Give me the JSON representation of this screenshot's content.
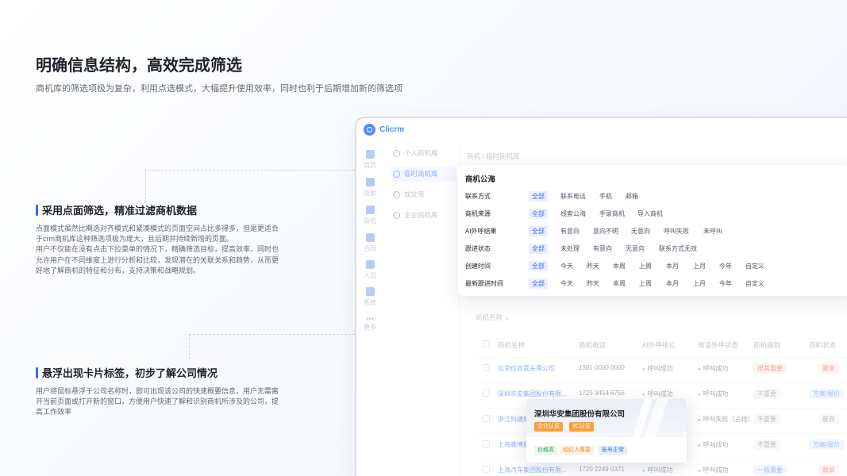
{
  "header": {
    "title": "明确信息结构，高效完成筛选",
    "subtitle": "商机库的筛选项极为复杂，利用点选模式，大幅提升使用效率，同时也利于后期增加新的筛选项"
  },
  "features": [
    {
      "title": "采用点面筛选，精准过滤商机数据",
      "lines": [
        "点面模式虽然比概选对齐模式和紧凑模式的页面空间占比多得多，但是更适合于crm商机库这种筛选项极为庞大，且后期并持续新增的页面。",
        "用户不仅能在没有点击下拉菜单的情况下，精确筛选目标，提高效率，同时也允许用户在不同维度上进行分析和比较，发现潜在的关联关系和趋势，从而更好地了解商机的特征和分布，支持决策和战略规划。"
      ]
    },
    {
      "title": "悬浮出现卡片标签，初步了解公司情况",
      "lines": [
        "用户将鼠标悬浮于公司名称时，即可出现该公司的快速概要信息，用户无需离开当前页面或打开新的窗口，方便用户快速了解和识别商机所涉及的公司，提高工作效率"
      ]
    }
  ],
  "app": {
    "logo": "Clicrm",
    "rail": [
      "首页",
      "线索",
      "商机",
      "合同",
      "人员",
      "系统",
      "更多"
    ],
    "nav": [
      {
        "label": "个人商机库",
        "active": false
      },
      {
        "label": "临时商机库",
        "active": true
      },
      {
        "label": "成交库",
        "active": false
      },
      {
        "label": "企业商机库",
        "active": false
      }
    ],
    "breadcrumb": "商机 / 临时商机库",
    "search_label": "商机名称"
  },
  "filter": {
    "title": "商机公海",
    "rows": [
      {
        "label": "联系方式",
        "options": [
          "全部",
          "联系电话",
          "手机",
          "邮箱"
        ]
      },
      {
        "label": "商机来源",
        "options": [
          "全部",
          "线索公海",
          "手录商机",
          "导入商机"
        ]
      },
      {
        "label": "AI外呼结果",
        "options": [
          "全部",
          "有意向",
          "意向不明",
          "无意向",
          "呼叫失败",
          "未呼叫"
        ]
      },
      {
        "label": "跟进状态",
        "options": [
          "全部",
          "未处理",
          "有意向",
          "无意向",
          "联系方式无效"
        ]
      },
      {
        "label": "创建时间",
        "options": [
          "全部",
          "今天",
          "昨天",
          "本周",
          "上周",
          "本月",
          "上月",
          "今年",
          "自定义"
        ]
      },
      {
        "label": "最新跟进时间",
        "options": [
          "全部",
          "今天",
          "昨天",
          "本周",
          "上周",
          "本月",
          "上月",
          "今年",
          "自定义"
        ]
      }
    ]
  },
  "table": {
    "columns": [
      "商机名称",
      "商机电话",
      "AI外呼结论",
      "电话外呼状态",
      "商机级别",
      "商机状态"
    ],
    "rows": [
      {
        "name": "北京红双喜头用公司",
        "phone": "1381 0000 0000",
        "ai": "呼叫成功",
        "call": "呼叫成功",
        "level": "很其重要",
        "status": "跟单"
      },
      {
        "name": "深圳华安集团股份有限...",
        "phone": "1725 3454 6756",
        "ai": "呼叫成功",
        "call": "呼叫成功",
        "level": "不重要",
        "status": "方案/报价"
      },
      {
        "name": "浙江科捷集团",
        "phone": "",
        "ai": "",
        "call": "呼叫失败（占线）",
        "level": "不重要",
        "status": "废弃"
      },
      {
        "name": "上海森博集",
        "phone": "",
        "ai": "",
        "call": "呼叫成功",
        "level": "不重要",
        "status": "方案/报价"
      },
      {
        "name": "上海汽车集团股份有限...",
        "phone": "1720 2249 0371",
        "ai": "呼叫成功",
        "call": "呼叫成功",
        "level": "一级重要",
        "status": "跟单"
      }
    ]
  },
  "hover_card": {
    "company": "深圳华安集团股份有限公司",
    "badges": [
      "企业认证",
      "3C认证"
    ],
    "tags": [
      "价格高",
      "经纪人重要",
      "账号正常"
    ]
  },
  "colors": {
    "accent": "#2f6bff",
    "badge": "#f7a23c"
  }
}
